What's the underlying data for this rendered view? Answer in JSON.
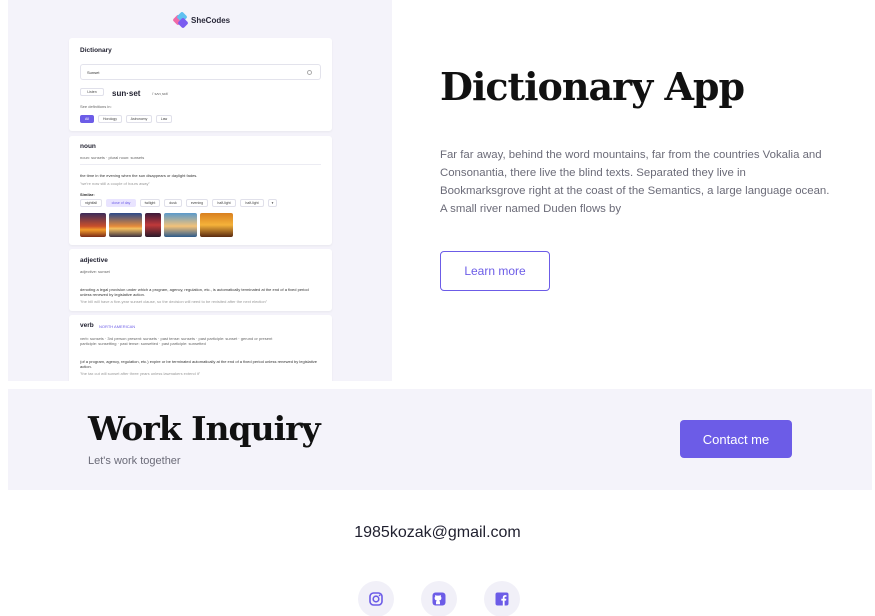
{
  "preview": {
    "brand": "SheCodes",
    "search_card": {
      "title": "Dictionary",
      "search_value": "Sunset",
      "listen_label": "Listen",
      "headword": "sun·set",
      "phonetic": "/ˈsʌnˌsɛt/",
      "see_definitions": "See definitions in:",
      "filters": [
        "All",
        "Horology",
        "Astronomy",
        "Law"
      ]
    },
    "noun_card": {
      "part_of_speech": "noun",
      "forms": "noun: sunsets  ·  plural noun: sunsets",
      "definition": "the time in the evening when the sun disappears or daylight fades.",
      "example": "\"we're now still a couple of hours away\"",
      "similar_label": "Similar:",
      "synonyms": [
        "nightfall",
        "close of day",
        "twilight",
        "dusk",
        "evening",
        "half-light",
        "half-light",
        "▾"
      ]
    },
    "adjective_card": {
      "part_of_speech": "adjective",
      "forms": "adjective: sunset",
      "definition": "denoting a legal provision under which a program, agency, regulation, etc., is automatically terminated at the end of a fixed period unless renewed by legislative action.",
      "example": "\"the bill will have a five-year sunset clause, so the decision will need to be revisited after the next election\""
    },
    "verb_card": {
      "part_of_speech": "verb",
      "tag": "NORTH AMERICAN",
      "forms_line_1": "verb: sunsets  ·  3rd person present: sunsets  ·  past tense: sunsets  ·  past participle: sunset  ·  gerund or present",
      "forms_line_2": "participle: sunsetting  ·  past tense: sunsetted  ·  past participle: sunsetted",
      "definition": "(of a program, agency, regulation, etc.) expire or be terminated automatically at the end of a fixed period unless renewed by legislative action.",
      "example": "\"the tax cut will sunset after three years unless lawmakers extend it\""
    }
  },
  "project": {
    "title": "Dictionary App",
    "description": "Far far away, behind the word mountains, far from the countries Vokalia and Consonantia, there live the blind texts. Separated they live in Bookmarksgrove right at the coast of the Semantics, a large language ocean. A small river named Duden flows by",
    "learn_more_label": "Learn more"
  },
  "inquiry": {
    "title": "Work Inquiry",
    "subtitle": "Let's work together",
    "contact_label": "Contact me"
  },
  "footer": {
    "email": "1985kozak@gmail.com",
    "social_icons": [
      "instagram-icon",
      "github-icon",
      "facebook-icon"
    ]
  },
  "colors": {
    "accent": "#6c5ce7",
    "section_background": "#f4f3fa",
    "heading": "#111111",
    "body_text": "#6b6b78"
  }
}
